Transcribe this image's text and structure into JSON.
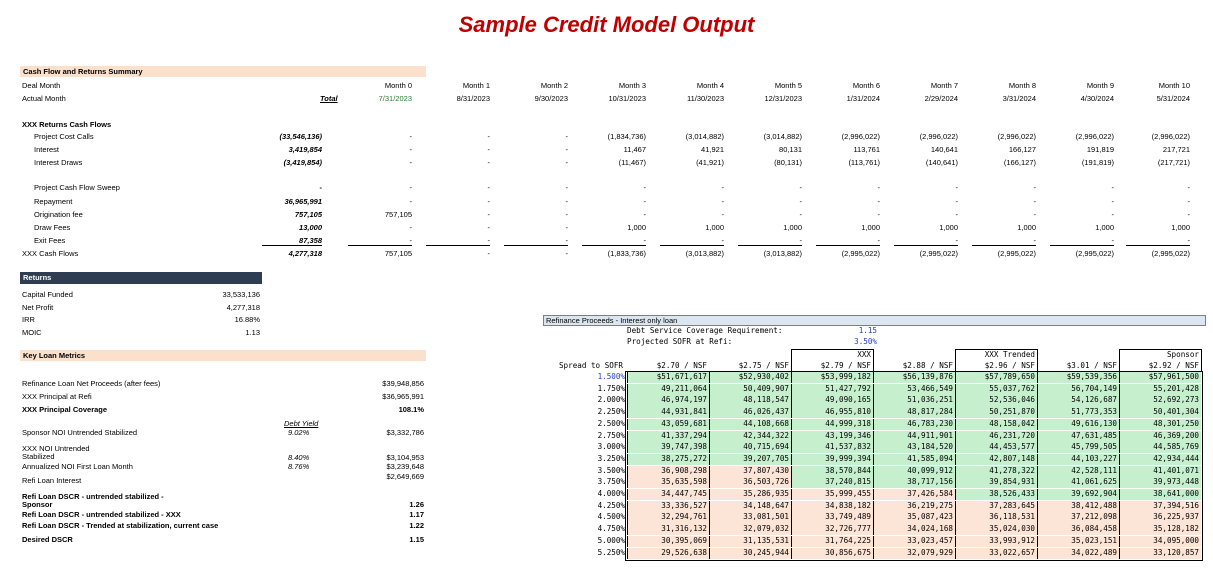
{
  "title": "Sample Credit Model Output",
  "summary": {
    "section_label": "Cash Flow and Returns Summary",
    "deal_month_label": "Deal Month",
    "actual_month_label": "Actual Month",
    "total_label": "Total",
    "months": [
      "Month 0",
      "Month 1",
      "Month 2",
      "Month 3",
      "Month 4",
      "Month 5",
      "Month 6",
      "Month 7",
      "Month 8",
      "Month 9",
      "Month 10"
    ],
    "dates": [
      "7/31/2023",
      "8/31/2023",
      "9/30/2023",
      "10/31/2023",
      "11/30/2023",
      "12/31/2023",
      "1/31/2024",
      "2/29/2024",
      "3/31/2024",
      "4/30/2024",
      "5/31/2024"
    ]
  },
  "cashflows": {
    "section_label": "XXX Returns Cash Flows",
    "rows": [
      {
        "label": "Project Cost Calls",
        "total": "(33,546,136)",
        "vals": [
          "-",
          "-",
          "-",
          "(1,834,736)",
          "(3,014,882)",
          "(3,014,882)",
          "(2,996,022)",
          "(2,996,022)",
          "(2,996,022)",
          "(2,996,022)",
          "(2,996,022)"
        ]
      },
      {
        "label": "Interest",
        "total": "3,419,854",
        "vals": [
          "-",
          "-",
          "-",
          "11,467",
          "41,921",
          "80,131",
          "113,761",
          "140,641",
          "166,127",
          "191,819",
          "217,721"
        ]
      },
      {
        "label": "Interest Draws",
        "total": "(3,419,854)",
        "vals": [
          "-",
          "-",
          "-",
          "(11,467)",
          "(41,921)",
          "(80,131)",
          "(113,761)",
          "(140,641)",
          "(166,127)",
          "(191,819)",
          "(217,721)"
        ]
      },
      {
        "label": "Project Cash Flow Sweep",
        "total": "-",
        "vals": [
          "-",
          "-",
          "-",
          "-",
          "-",
          "-",
          "-",
          "-",
          "-",
          "-",
          "-"
        ]
      },
      {
        "label": "Repayment",
        "total": "36,965,991",
        "vals": [
          "-",
          "-",
          "-",
          "-",
          "-",
          "-",
          "-",
          "-",
          "-",
          "-",
          "-"
        ]
      },
      {
        "label": "Origination fee",
        "total": "757,105",
        "vals": [
          "757,105",
          "-",
          "-",
          "-",
          "-",
          "-",
          "-",
          "-",
          "-",
          "-",
          "-"
        ]
      },
      {
        "label": "Draw Fees",
        "total": "13,000",
        "vals": [
          "-",
          "-",
          "-",
          "1,000",
          "1,000",
          "1,000",
          "1,000",
          "1,000",
          "1,000",
          "1,000",
          "1,000"
        ]
      },
      {
        "label": "Exit Fees",
        "total": "87,358",
        "vals": [
          "-",
          "-",
          "-",
          "-",
          "-",
          "-",
          "-",
          "-",
          "-",
          "-",
          "-"
        ]
      },
      {
        "label": "XXX Cash Flows",
        "total": "4,277,318",
        "vals": [
          "757,105",
          "-",
          "-",
          "(1,833,736)",
          "(3,013,882)",
          "(3,013,882)",
          "(2,995,022)",
          "(2,995,022)",
          "(2,995,022)",
          "(2,995,022)",
          "(2,995,022)"
        ]
      }
    ]
  },
  "returns": {
    "header": "Returns",
    "rows": [
      {
        "label": "Capital Funded",
        "value": "33,533,136"
      },
      {
        "label": "Net Profit",
        "value": "4,277,318"
      },
      {
        "label": "IRR",
        "value": "16.88%"
      },
      {
        "label": "MOIC",
        "value": "1.13"
      }
    ]
  },
  "klm": {
    "header": "Key Loan Metrics",
    "refi_net": {
      "label": "Refinance Loan Net Proceeds (after fees)",
      "value": "$39,948,856"
    },
    "principal": {
      "label": "XXX Principal at Refi",
      "value": "$36,965,991"
    },
    "coverage": {
      "label": "XXX Principal Coverage",
      "value": "108.1%"
    },
    "debt_yield_label": "Debt Yield",
    "sponsor_noi": {
      "label": "Sponsor NOI Untrended Stabilized",
      "dy": "9.02%",
      "value": "$3,332,786"
    },
    "xxx_noi_line1": "XXX NOI Untrended",
    "xxx_noi_line2": "Stabilized",
    "xxx_noi_dy": "8.40%",
    "xxx_noi_value": "$3,104,953",
    "annualized": {
      "label": "Annualized NOI First Loan Month",
      "dy": "8.76%",
      "value": "$3,239,648"
    },
    "refi_interest": {
      "label": "Refi Loan Interest",
      "value": "$2,649,669"
    },
    "dscr1_line1": "Refi Loan DSCR - untrended stabilized -",
    "dscr1_line2": "Sponsor",
    "dscr1_value": "1.26",
    "dscr2": {
      "label": "Refi Loan DSCR - untrended stabilized - XXX",
      "value": "1.17"
    },
    "dscr3": {
      "label": "Refi Loan DSCR - Trended at stabilization, current case",
      "value": "1.22"
    },
    "desired": {
      "label": "Desired DSCR",
      "value": "1.15"
    }
  },
  "refi": {
    "title": "Refinance Proceeds - Interest only loan",
    "dscr_req_label": "Debt Service Coverage Requirement:",
    "dscr_req_value": "1.15",
    "sofr_label": "Projected SOFR at Refi:",
    "sofr_value": "3.50%",
    "spread_label": "Spread to SOFR",
    "col_tags": [
      "",
      "",
      "XXX",
      "",
      "XXX Trended",
      "",
      "Sponsor"
    ],
    "col_heads": [
      "$2.70 / NSF",
      "$2.75 / NSF",
      "$2.79 / NSF",
      "$2.88 / NSF",
      "$2.96 / NSF",
      "$3.01 / NSF",
      "$2.92 / NSF"
    ],
    "spreads": [
      "1.500%",
      "1.750%",
      "2.000%",
      "2.250%",
      "2.500%",
      "2.750%",
      "3.000%",
      "3.250%",
      "3.500%",
      "3.750%",
      "4.000%",
      "4.250%",
      "4.500%",
      "4.750%",
      "5.000%",
      "5.250%"
    ],
    "values": [
      [
        "$51,671,617",
        "$52,930,402",
        "$53,999,182",
        "$56,139,876",
        "$57,789,650",
        "$59,539,356",
        "$57,961,500"
      ],
      [
        "49,211,064",
        "50,409,907",
        "51,427,792",
        "53,466,549",
        "55,037,762",
        "56,704,149",
        "55,201,428"
      ],
      [
        "46,974,197",
        "48,118,547",
        "49,090,165",
        "51,036,251",
        "52,536,046",
        "54,126,687",
        "52,692,273"
      ],
      [
        "44,931,841",
        "46,026,437",
        "46,955,810",
        "48,817,284",
        "50,251,870",
        "51,773,353",
        "50,401,304"
      ],
      [
        "43,059,681",
        "44,108,668",
        "44,999,318",
        "46,783,230",
        "48,158,042",
        "49,616,130",
        "48,301,250"
      ],
      [
        "41,337,294",
        "42,344,322",
        "43,199,346",
        "44,911,901",
        "46,231,720",
        "47,631,485",
        "46,369,200"
      ],
      [
        "39,747,398",
        "40,715,694",
        "41,537,832",
        "43,184,520",
        "44,453,577",
        "45,799,505",
        "44,585,769"
      ],
      [
        "38,275,272",
        "39,207,705",
        "39,999,394",
        "41,585,094",
        "42,807,148",
        "44,103,227",
        "42,934,444"
      ],
      [
        "36,908,298",
        "37,807,430",
        "38,570,844",
        "40,099,912",
        "41,278,322",
        "42,528,111",
        "41,401,071"
      ],
      [
        "35,635,598",
        "36,503,726",
        "37,240,815",
        "38,717,156",
        "39,854,931",
        "41,061,625",
        "39,973,448"
      ],
      [
        "34,447,745",
        "35,286,935",
        "35,999,455",
        "37,426,584",
        "38,526,433",
        "39,692,904",
        "38,641,000"
      ],
      [
        "33,336,527",
        "34,148,647",
        "34,838,182",
        "36,219,275",
        "37,283,645",
        "38,412,488",
        "37,394,516"
      ],
      [
        "32,294,761",
        "33,081,501",
        "33,749,489",
        "35,087,423",
        "36,118,531",
        "37,212,098",
        "36,225,937"
      ],
      [
        "31,316,132",
        "32,079,032",
        "32,726,777",
        "34,024,168",
        "35,024,030",
        "36,084,458",
        "35,128,182"
      ],
      [
        "30,395,069",
        "31,135,531",
        "31,764,225",
        "33,023,457",
        "33,993,912",
        "35,023,151",
        "34,095,000"
      ],
      [
        "29,526,638",
        "30,245,944",
        "30,856,675",
        "32,079,929",
        "33,022,657",
        "34,022,489",
        "33,120,857"
      ]
    ],
    "green_rows_by_col": [
      8,
      8,
      10,
      10,
      11,
      11,
      11
    ]
  }
}
